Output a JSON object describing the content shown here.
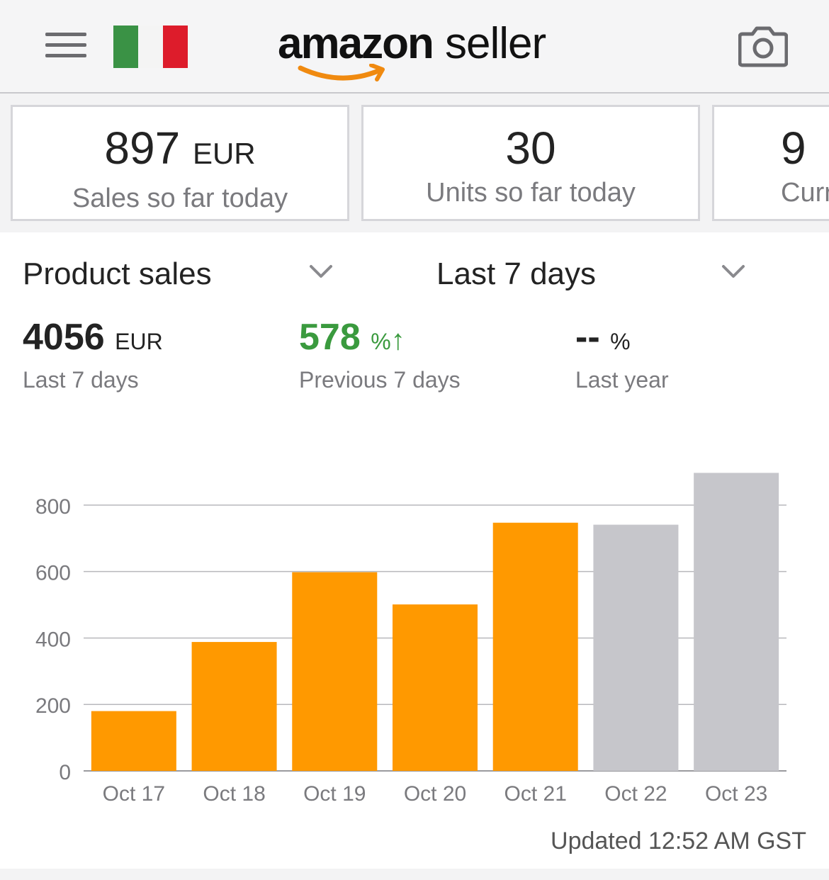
{
  "header": {
    "brand_bold": "amazon",
    "brand_light": "seller",
    "flag_colors": [
      "#3a9245",
      "#f4f4f4",
      "#dd1c2b"
    ],
    "accent": "#f08a10"
  },
  "cards": [
    {
      "value": "897",
      "unit": "EUR",
      "label": "Sales so far today"
    },
    {
      "value": "30",
      "unit": "",
      "label": "Units so far today"
    },
    {
      "value": "9",
      "unit": "",
      "label": "Curr"
    }
  ],
  "selectors": {
    "metric": "Product sales",
    "period": "Last 7 days"
  },
  "stats": [
    {
      "value": "4056",
      "unit": "EUR",
      "label": "Last 7 days",
      "color": "#232323"
    },
    {
      "value": "578",
      "unit": "%",
      "arrow": "↑",
      "label": "Previous 7 days",
      "color": "#3a9a3e"
    },
    {
      "value": "--",
      "unit": "%",
      "label": "Last year",
      "color": "#232323"
    }
  ],
  "chart_data": {
    "type": "bar",
    "categories": [
      "Oct 17",
      "Oct 18",
      "Oct 19",
      "Oct 20",
      "Oct 21",
      "Oct 22",
      "Oct 23"
    ],
    "values": [
      180,
      388,
      598,
      501,
      747,
      741,
      897
    ],
    "colors": [
      "#ff9900",
      "#ff9900",
      "#ff9900",
      "#ff9900",
      "#ff9900",
      "#c6c6cb",
      "#c6c6cb"
    ],
    "yticks": [
      0,
      200,
      400,
      600,
      800
    ],
    "ylim": [
      0,
      900
    ],
    "grid": true
  },
  "updated": "Updated 12:52 AM GST"
}
